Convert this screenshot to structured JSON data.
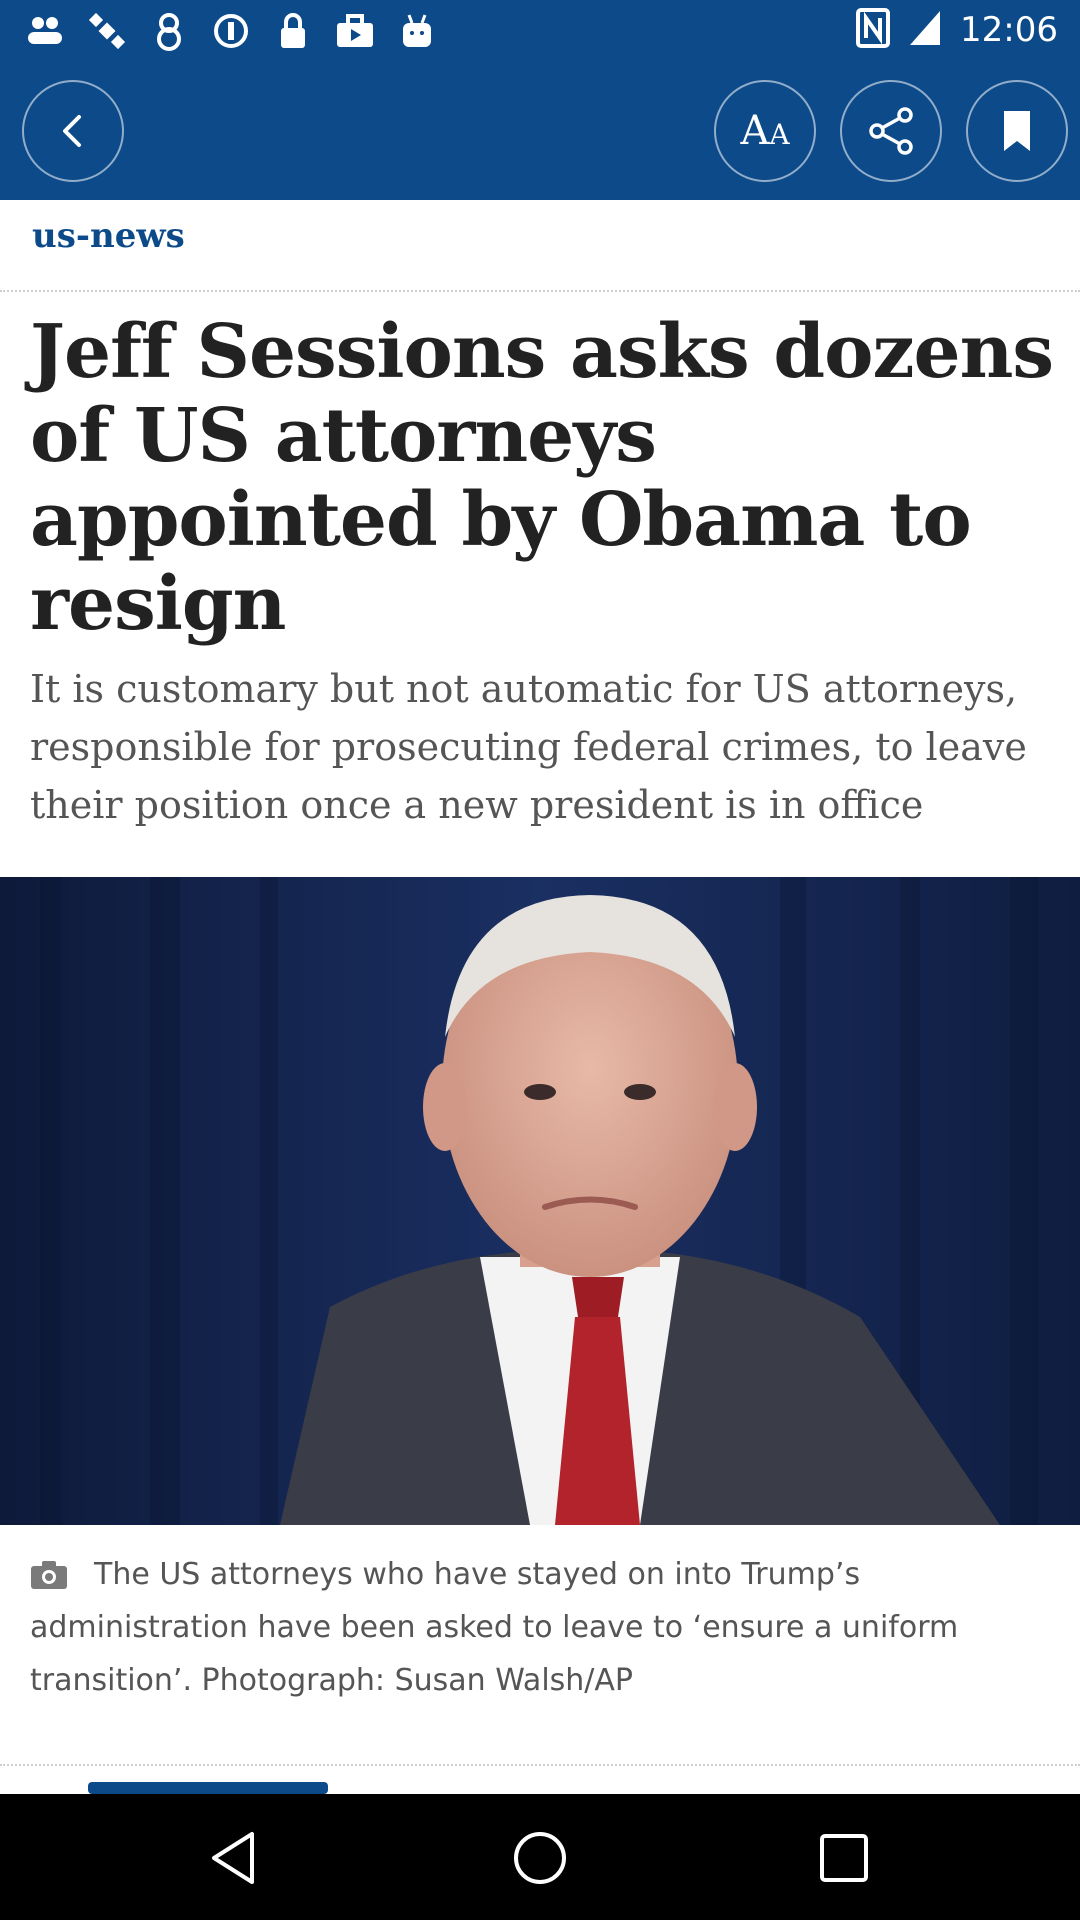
{
  "status_bar": {
    "time": "12:06",
    "icons": [
      "people-icon",
      "satellite-icon",
      "alarm-icon",
      "data-saver-icon",
      "lock-icon",
      "briefcase-icon",
      "android-icon"
    ],
    "right_icons": [
      "nfc-icon",
      "signal-icon"
    ],
    "background": "#0c4a8a"
  },
  "toolbar": {
    "back_icon": "back-arrow-icon",
    "text_size_label": "AA",
    "share_icon": "share-icon",
    "bookmark_icon": "bookmark-icon"
  },
  "article": {
    "section": "us-news",
    "headline": "Jeff Sessions asks dozens of US attorneys appointed by Obama to resign",
    "standfirst": "It is customary but not automatic for US attorneys, responsible for prosecuting federal crimes, to leave their position once a new president is in office",
    "image_alt": "Jeff Sessions photo",
    "caption": "The US attorneys who have stayed on into Trump’s administration have been asked to leave to ‘ensure a uniform transition’. Photograph: Susan Walsh/AP",
    "caption_icon": "camera-icon"
  },
  "nav": {
    "back": "nav-back-icon",
    "home": "nav-home-icon",
    "recent": "nav-recent-icon"
  },
  "colors": {
    "accent": "#0c4a8a",
    "headline": "#222222",
    "subtext": "#555555"
  }
}
